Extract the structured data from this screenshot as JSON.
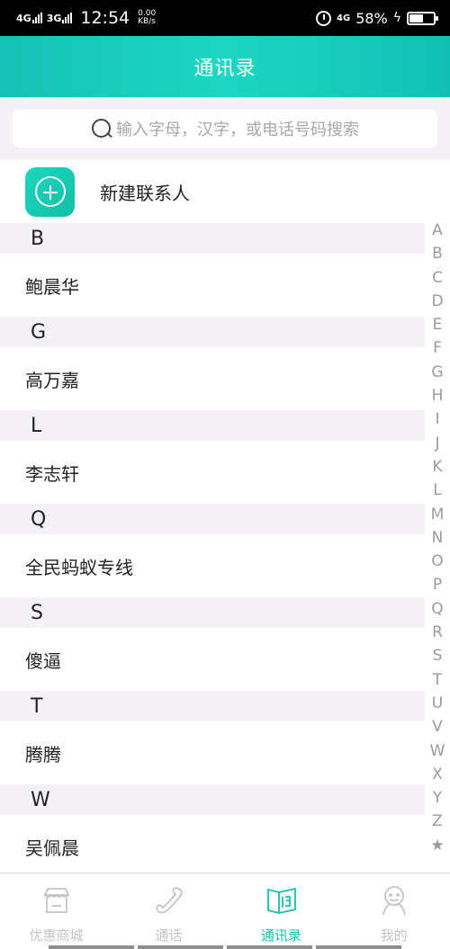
{
  "status_bar": {
    "net1": "4G",
    "net2": "3G",
    "time": "12:54",
    "speed_value": "0.00",
    "speed_unit": "KB/s",
    "net3": "4G",
    "battery": "58%",
    "battery_level": 0.58
  },
  "header": {
    "title": "通讯录"
  },
  "search": {
    "placeholder": "输入字母，汉字，或电话号码搜索"
  },
  "new_contact": {
    "label": "新建联系人"
  },
  "contacts": [
    {
      "letter": "B",
      "name": "鲍晨华"
    },
    {
      "letter": "G",
      "name": "高万嘉"
    },
    {
      "letter": "L",
      "name": "李志轩"
    },
    {
      "letter": "Q",
      "name": "全民蚂蚁专线"
    },
    {
      "letter": "S",
      "name": "傻逼"
    },
    {
      "letter": "T",
      "name": "腾腾"
    },
    {
      "letter": "W",
      "name": "吴佩晨"
    }
  ],
  "alphabet": [
    "A",
    "B",
    "C",
    "D",
    "E",
    "F",
    "G",
    "H",
    "I",
    "J",
    "K",
    "L",
    "M",
    "N",
    "O",
    "P",
    "Q",
    "R",
    "S",
    "T",
    "U",
    "V",
    "W",
    "X",
    "Y",
    "Z",
    "★"
  ],
  "bottom_nav": {
    "items": [
      {
        "label": "优惠商城",
        "icon": "store-icon",
        "active": false
      },
      {
        "label": "通话",
        "icon": "phone-icon",
        "active": false
      },
      {
        "label": "通讯录",
        "icon": "contacts-book-icon",
        "active": true
      },
      {
        "label": "我的",
        "icon": "profile-icon",
        "active": false
      }
    ]
  },
  "colors": {
    "accent": "#16bfae",
    "inactive": "#c4c4c4",
    "section_bg": "#f4f2f6"
  }
}
